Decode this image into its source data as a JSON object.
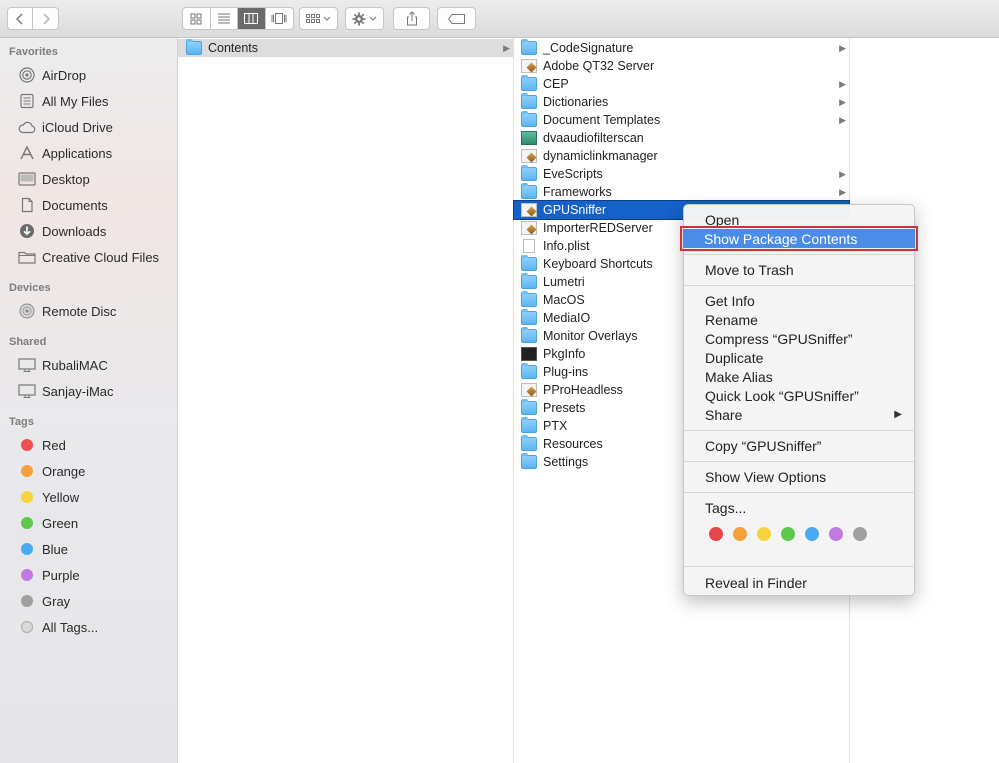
{
  "toolbar": {
    "back": "back-arrow",
    "forward": "forward-arrow",
    "views": [
      "icon-view",
      "list-view",
      "column-view",
      "cover-flow-view"
    ],
    "active_view": 2
  },
  "sidebar": {
    "favorites_label": "Favorites",
    "favorites": [
      {
        "label": "AirDrop",
        "icon": "airdrop-icon"
      },
      {
        "label": "All My Files",
        "icon": "all-files-icon"
      },
      {
        "label": "iCloud Drive",
        "icon": "cloud-icon"
      },
      {
        "label": "Applications",
        "icon": "applications-icon"
      },
      {
        "label": "Desktop",
        "icon": "desktop-icon"
      },
      {
        "label": "Documents",
        "icon": "documents-icon"
      },
      {
        "label": "Downloads",
        "icon": "downloads-icon"
      },
      {
        "label": "Creative Cloud Files",
        "icon": "folder-icon"
      }
    ],
    "devices_label": "Devices",
    "devices": [
      {
        "label": "Remote Disc",
        "icon": "disc-icon"
      }
    ],
    "shared_label": "Shared",
    "shared": [
      {
        "label": "RubaliMAC",
        "icon": "monitor-icon"
      },
      {
        "label": "Sanjay-iMac",
        "icon": "monitor-icon"
      }
    ],
    "tags_label": "Tags",
    "tags": [
      {
        "label": "Red",
        "color": "#f05050"
      },
      {
        "label": "Orange",
        "color": "#f5a03c"
      },
      {
        "label": "Yellow",
        "color": "#f7d23c"
      },
      {
        "label": "Green",
        "color": "#5cc84c"
      },
      {
        "label": "Blue",
        "color": "#4aaaf0"
      },
      {
        "label": "Purple",
        "color": "#c27ae0"
      },
      {
        "label": "Gray",
        "color": "#a0a0a0"
      },
      {
        "label": "All Tags...",
        "color": "#d8d8d8"
      }
    ]
  },
  "column1": {
    "items": [
      {
        "label": "Contents",
        "type": "folder"
      }
    ]
  },
  "column2": {
    "items": [
      {
        "label": "_CodeSignature",
        "type": "folder",
        "arrow": true
      },
      {
        "label": "Adobe QT32 Server",
        "type": "app"
      },
      {
        "label": "CEP",
        "type": "folder",
        "arrow": true
      },
      {
        "label": "Dictionaries",
        "type": "folder",
        "arrow": true
      },
      {
        "label": "Document Templates",
        "type": "folder",
        "arrow": true
      },
      {
        "label": "dvaaudiofilterscan",
        "type": "green"
      },
      {
        "label": "dynamiclinkmanager",
        "type": "app"
      },
      {
        "label": "EveScripts",
        "type": "folder",
        "arrow": true
      },
      {
        "label": "Frameworks",
        "type": "folder",
        "arrow": true
      },
      {
        "label": "GPUSniffer",
        "type": "app",
        "selected": true
      },
      {
        "label": "ImporterREDServer",
        "type": "app"
      },
      {
        "label": "Info.plist",
        "type": "doc"
      },
      {
        "label": "Keyboard Shortcuts",
        "type": "folder"
      },
      {
        "label": "Lumetri",
        "type": "folder"
      },
      {
        "label": "MacOS",
        "type": "folder"
      },
      {
        "label": "MediaIO",
        "type": "folder"
      },
      {
        "label": "Monitor Overlays",
        "type": "folder"
      },
      {
        "label": "PkgInfo",
        "type": "term"
      },
      {
        "label": "Plug-ins",
        "type": "folder"
      },
      {
        "label": "PProHeadless",
        "type": "app"
      },
      {
        "label": "Presets",
        "type": "folder"
      },
      {
        "label": "PTX",
        "type": "folder"
      },
      {
        "label": "Resources",
        "type": "folder"
      },
      {
        "label": "Settings",
        "type": "folder"
      }
    ]
  },
  "context_menu": {
    "open": "Open",
    "show_package_contents": "Show Package Contents",
    "move_to_trash": "Move to Trash",
    "get_info": "Get Info",
    "rename": "Rename",
    "compress": "Compress “GPUSniffer”",
    "duplicate": "Duplicate",
    "make_alias": "Make Alias",
    "quick_look": "Quick Look “GPUSniffer”",
    "share": "Share",
    "copy": "Copy “GPUSniffer”",
    "show_view_options": "Show View Options",
    "tags": "Tags...",
    "tag_colors": [
      "#e8464a",
      "#f5a03c",
      "#f7d23c",
      "#5cc84c",
      "#4aaaf0",
      "#c27ae0",
      "#a0a0a0"
    ],
    "reveal_in_finder": "Reveal in Finder"
  }
}
